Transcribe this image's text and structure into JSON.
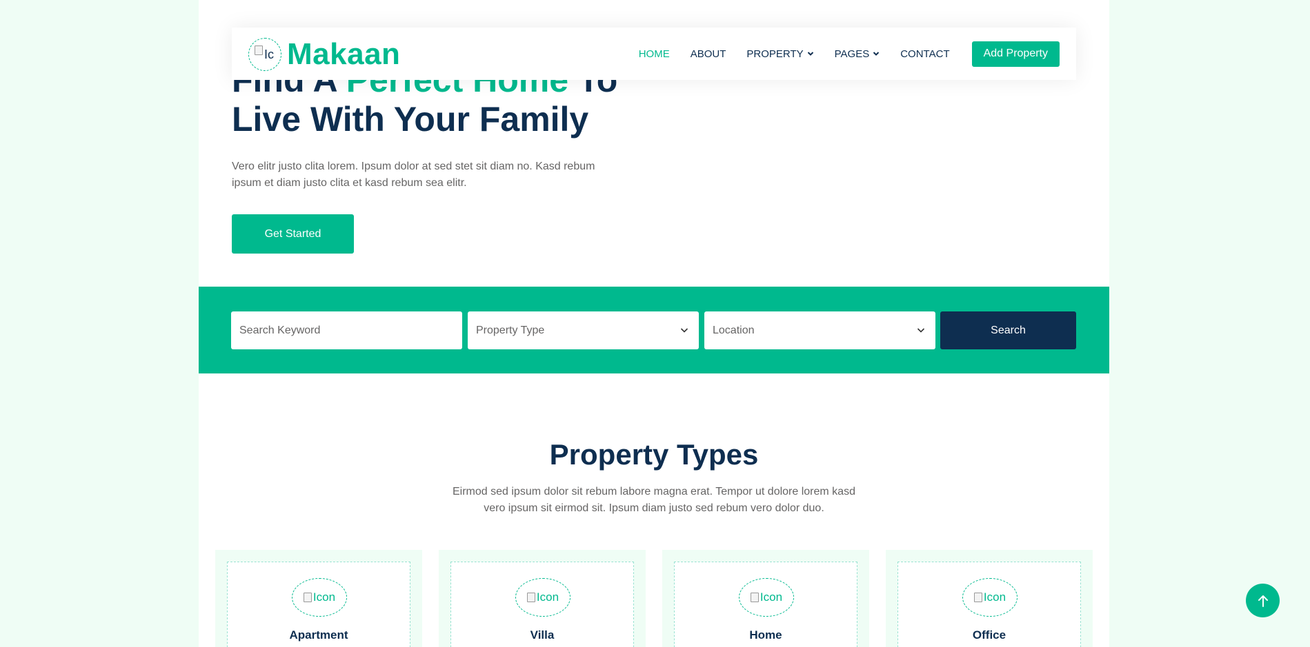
{
  "brand": {
    "icon_alt": "Ic",
    "name": "Makaan"
  },
  "nav": {
    "items": [
      {
        "label": "HOME",
        "active": true
      },
      {
        "label": "ABOUT"
      },
      {
        "label": "PROPERTY",
        "dropdown": true
      },
      {
        "label": "PAGES",
        "dropdown": true
      },
      {
        "label": "CONTACT"
      }
    ],
    "cta_label": "Add Property"
  },
  "hero": {
    "title_part1": "Find A ",
    "title_accent": "Perfect Home",
    "title_part2": " To Live With Your Family",
    "text": "Vero elitr justo clita lorem. Ipsum dolor at sed stet sit diam no. Kasd rebum ipsum et diam justo clita et kasd rebum sea elitr.",
    "button_label": "Get Started"
  },
  "search": {
    "keyword_placeholder": "Search Keyword",
    "property_type_value": "Property Type",
    "location_value": "Location",
    "button_label": "Search"
  },
  "property_types": {
    "title": "Property Types",
    "text": "Eirmod sed ipsum dolor sit rebum labore magna erat. Tempor ut dolore lorem kasd vero ipsum sit eirmod sit. Ipsum diam justo sed rebum vero dolor duo.",
    "icon_alt": "Icon",
    "cards": [
      {
        "label": "Apartment"
      },
      {
        "label": "Villa"
      },
      {
        "label": "Home"
      },
      {
        "label": "Office"
      }
    ]
  },
  "colors": {
    "accent": "#00b98e",
    "dark": "#0e2e50",
    "light_bg": "#effdf5",
    "text": "#666565"
  },
  "icons": {
    "back_to_top": "arrow-up-icon",
    "dropdown": "chevron-down-icon"
  }
}
